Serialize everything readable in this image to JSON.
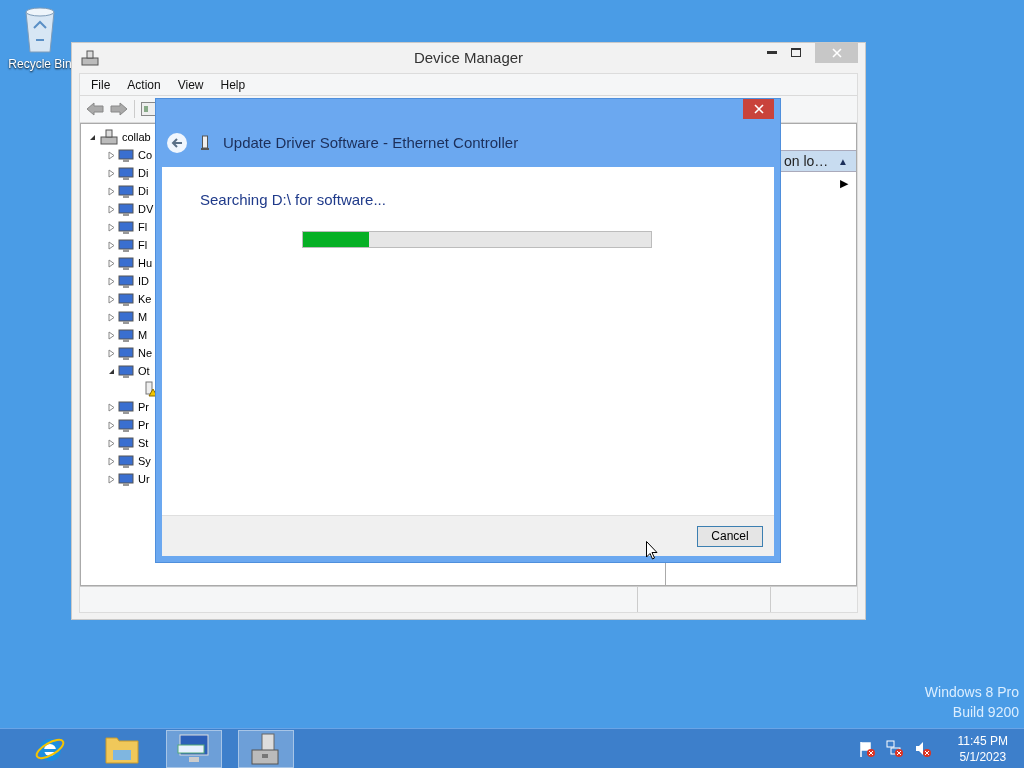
{
  "desktop_icons": [
    {
      "label": "Recycle Bin"
    }
  ],
  "device_manager": {
    "title": "Device Manager",
    "menu": [
      "File",
      "Action",
      "View",
      "Help"
    ],
    "tree": {
      "label": "collab",
      "expanded": true,
      "children": [
        {
          "label": "Co",
          "expanded": false
        },
        {
          "label": "Di",
          "expanded": false
        },
        {
          "label": "Di",
          "expanded": false
        },
        {
          "label": "DV",
          "expanded": false
        },
        {
          "label": "Fl",
          "expanded": false
        },
        {
          "label": "Fl",
          "expanded": false
        },
        {
          "label": "Hu",
          "expanded": false
        },
        {
          "label": "ID",
          "expanded": false
        },
        {
          "label": "Ke",
          "expanded": false
        },
        {
          "label": "M",
          "expanded": false
        },
        {
          "label": "M",
          "expanded": false
        },
        {
          "label": "Ne",
          "expanded": false
        },
        {
          "label": "Ot",
          "expanded": true,
          "children": [
            {
              "kind": "warning-device"
            }
          ]
        },
        {
          "label": "Pr",
          "expanded": false
        },
        {
          "label": "Pr",
          "expanded": false
        },
        {
          "label": "St",
          "expanded": false
        },
        {
          "label": "Sy",
          "expanded": false
        },
        {
          "label": "Ur",
          "expanded": false
        }
      ]
    },
    "side_pane": {
      "header": "on lo…",
      "header_arrow": "▲",
      "item_arrow": "▶"
    }
  },
  "dialog": {
    "title": "Update Driver Software - Ethernet Controller",
    "message": "Searching D:\\ for software...",
    "progress": {
      "level": 0.19
    },
    "buttons": [
      "Cancel"
    ]
  },
  "watermark_text": [
    "Windows 8 Pro",
    "Build 9200"
  ],
  "taskbar": {
    "apps": [
      {
        "kind": "browser",
        "active": false
      },
      {
        "kind": "folder",
        "active": false
      },
      {
        "kind": "keyboard",
        "active": true
      },
      {
        "kind": "device-manager",
        "active": true
      }
    ],
    "clock": {
      "time": "11:45 PM",
      "date": "5/1/2023"
    }
  }
}
